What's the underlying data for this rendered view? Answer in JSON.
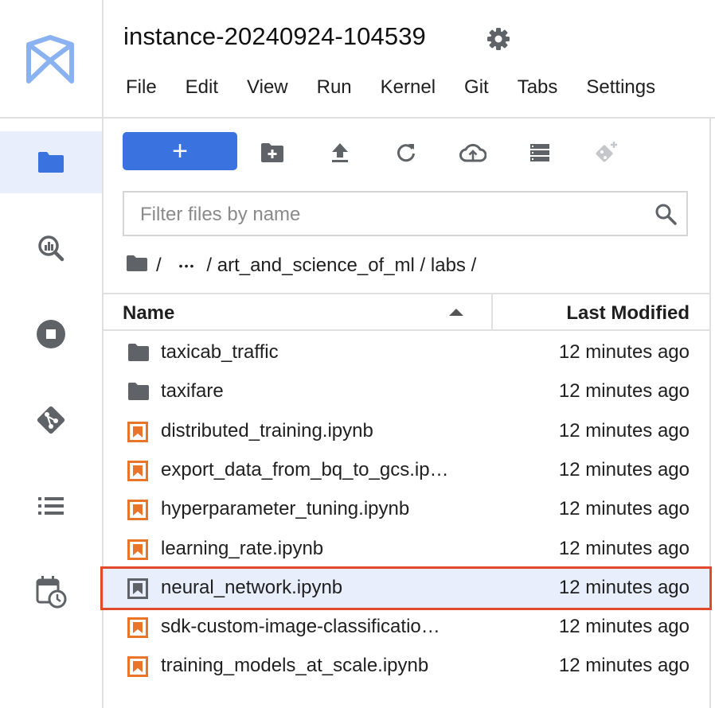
{
  "header": {
    "title": "instance-20240924-104539",
    "menu": [
      "File",
      "Edit",
      "View",
      "Run",
      "Kernel",
      "Git",
      "Tabs",
      "Settings"
    ]
  },
  "sidebar": {
    "items": [
      {
        "icon": "folder-icon",
        "active": true
      },
      {
        "icon": "bigquery-icon",
        "active": false
      },
      {
        "icon": "stop-icon",
        "active": false
      },
      {
        "icon": "git-icon",
        "active": false
      },
      {
        "icon": "list-icon",
        "active": false
      },
      {
        "icon": "calendar-clock-icon",
        "active": false
      }
    ]
  },
  "toolbar": {
    "new_label": "+",
    "icons": [
      "new-folder-icon",
      "upload-icon",
      "refresh-icon",
      "cloud-upload-icon",
      "storage-icon",
      "git-clone-icon"
    ]
  },
  "filter": {
    "placeholder": "Filter files by name",
    "value": ""
  },
  "breadcrumb": {
    "root": "/",
    "ellipsis": "•••",
    "path": "/ art_and_science_of_ml / labs /"
  },
  "listing": {
    "col_name": "Name",
    "col_modified": "Last Modified",
    "rows": [
      {
        "type": "folder",
        "name": "taxicab_traffic",
        "modified": "12 minutes ago"
      },
      {
        "type": "folder",
        "name": "taxifare",
        "modified": "12 minutes ago"
      },
      {
        "type": "notebook",
        "name": "distributed_training.ipynb",
        "modified": "12 minutes ago"
      },
      {
        "type": "notebook",
        "name": "export_data_from_bq_to_gcs.ip…",
        "modified": "12 minutes ago"
      },
      {
        "type": "notebook",
        "name": "hyperparameter_tuning.ipynb",
        "modified": "12 minutes ago"
      },
      {
        "type": "notebook",
        "name": "learning_rate.ipynb",
        "modified": "12 minutes ago"
      },
      {
        "type": "notebook",
        "name": "neural_network.ipynb",
        "modified": "12 minutes ago",
        "selected": true
      },
      {
        "type": "notebook",
        "name": "sdk-custom-image-classificatio…",
        "modified": "12 minutes ago"
      },
      {
        "type": "notebook",
        "name": "training_models_at_scale.ipynb",
        "modified": "12 minutes ago"
      }
    ]
  },
  "colors": {
    "accent": "#3a72e0",
    "selected_row": "#e8eefb",
    "highlight": "#e2492b",
    "notebook_icon": "#e8752a",
    "logo": "#8ab2f0"
  }
}
